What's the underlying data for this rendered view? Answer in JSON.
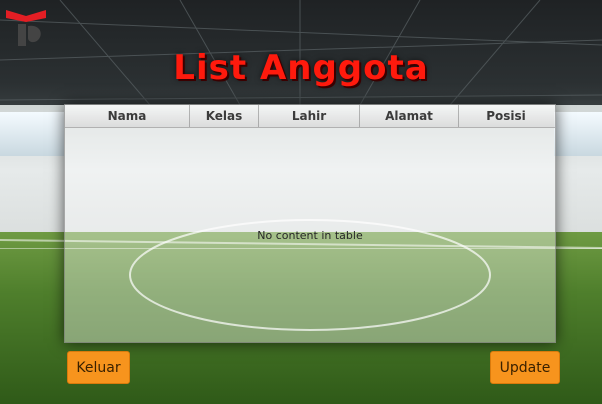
{
  "title": "List Anggota",
  "table": {
    "columns": [
      "Nama",
      "Kelas",
      "Lahir",
      "Alamat",
      "Posisi"
    ],
    "rows": [],
    "empty_text": "No content in table"
  },
  "buttons": {
    "exit_label": "Keluar",
    "update_label": "Update"
  },
  "colors": {
    "title": "#ff1a0d",
    "button": "#f7941d"
  }
}
